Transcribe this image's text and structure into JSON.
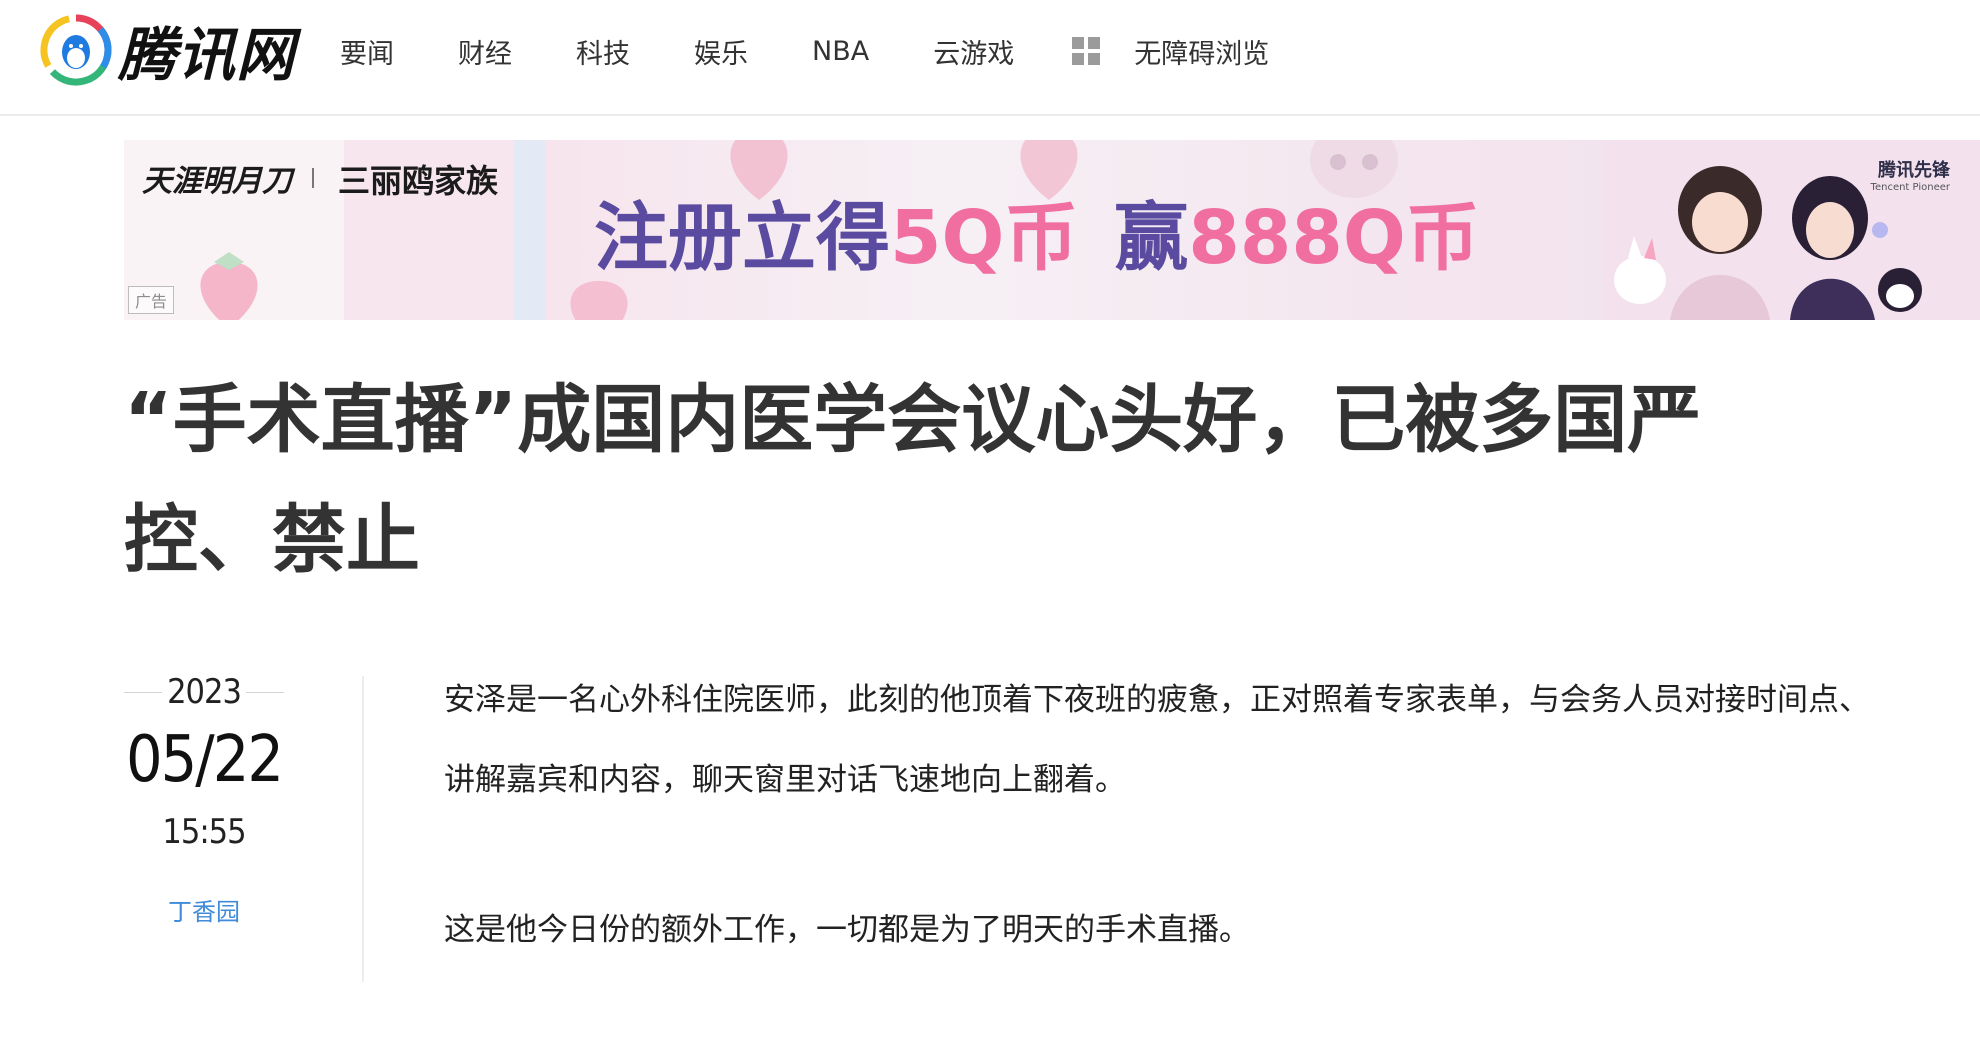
{
  "header": {
    "logo_text": "腾讯网",
    "nav": [
      "要闻",
      "财经",
      "科技",
      "娱乐",
      "NBA",
      "云游戏"
    ],
    "accessibility_label": "无障碍浏览"
  },
  "ad": {
    "brand1": "天涯明月刀",
    "brand2": "三丽鸥家族",
    "headline_part1": "注册立得",
    "headline_part2": "5Q币",
    "headline_part3": "赢",
    "headline_part4": "888Q币",
    "label": "广告",
    "pioneer": "腾讯先锋",
    "pioneer_en": "Tencent Pioneer"
  },
  "article": {
    "title": "“手术直播”成国内医学会议心头好，已被多国严控、禁止",
    "year": "2023",
    "date": "05/22",
    "time": "15:55",
    "source": "丁香园",
    "paragraphs": [
      "安泽是一名心外科住院医师，此刻的他顶着下夜班的疲惫，正对照着专家表单，与会务人员对接时间点、讲解嘉宾和内容，聊天窗里对话飞速地向上翻着。",
      "这是他今日份的额外工作，一切都是为了明天的手术直播。"
    ]
  },
  "colors": {
    "accent_link": "#3f8bd9",
    "ad_purple": "#5a4aa0",
    "ad_pink": "#f06ea0"
  }
}
